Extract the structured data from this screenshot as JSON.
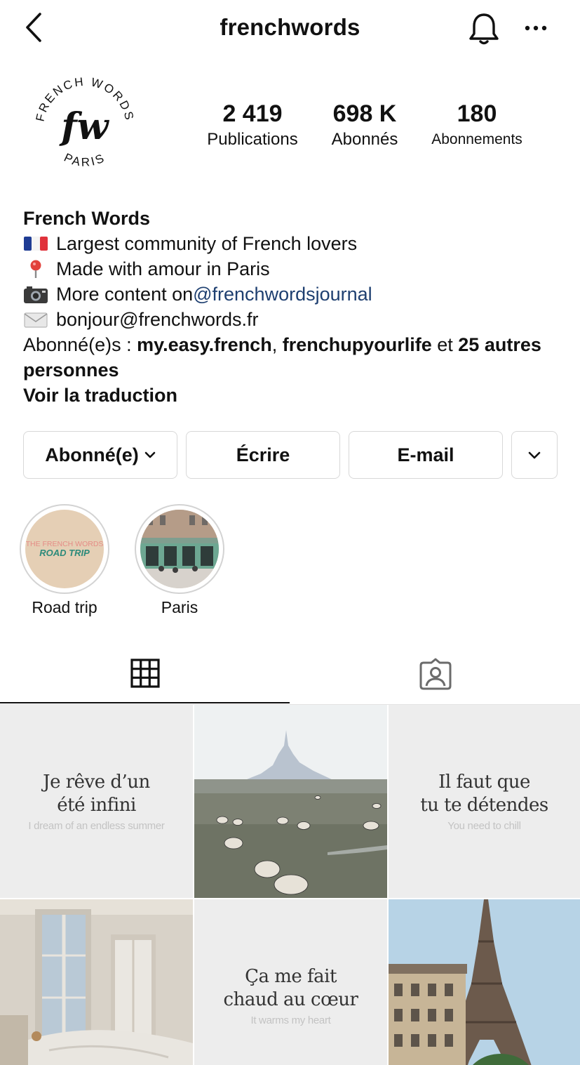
{
  "header": {
    "title": "frenchwords"
  },
  "profile": {
    "avatar_lines": {
      "top": "FRENCH WORDS",
      "bottom": "PARIS",
      "monogram": "fw"
    },
    "stats": [
      {
        "value": "2 419",
        "label": "Publications"
      },
      {
        "value": "698 K",
        "label": "Abonnés"
      },
      {
        "value": "180",
        "label": "Abonnements"
      }
    ],
    "name": "French Words",
    "bio_lines": [
      {
        "icon": "france-flag-icon",
        "text": "Largest community of French lovers"
      },
      {
        "icon": "pin-icon",
        "text": "Made with amour in Paris"
      },
      {
        "icon": "camera-icon",
        "text": "More content on ",
        "mention": "@frenchwordsjournal"
      },
      {
        "icon": "envelope-icon",
        "text": "bonjour@frenchwords.fr"
      }
    ],
    "followed_by": {
      "prefix": "Abonné(e)s : ",
      "user1": "my.easy.french",
      "sep": ", ",
      "user2": "frenchupyourlife",
      "mid": " et ",
      "others": "25 autres personnes"
    },
    "translate_label": "Voir la traduction"
  },
  "actions": {
    "follow_label": "Abonné(e)",
    "write_label": "Écrire",
    "email_label": "E-mail"
  },
  "highlights": [
    {
      "caption": "Road trip",
      "cover_text_top": "THE FRENCH WORDS",
      "cover_text_bottom": "ROAD TRIP"
    },
    {
      "caption": "Paris"
    }
  ],
  "posts": [
    {
      "fr_1": "Je rêve d’un",
      "fr_2": "été infini",
      "en": "I dream of an endless summer"
    },
    {
      "fr_1": "Il faut que",
      "fr_2": "tu te détendes",
      "en": "You need to chill"
    },
    {
      "fr_1": "Ça me fait",
      "fr_2": "chaud au cœur",
      "en": "It warms my heart"
    }
  ],
  "colors": {
    "mention": "#1e3f70",
    "border": "#d8d8d8",
    "quote_bg": "#ededed",
    "highlight_road_bg": "#e5cfb5",
    "road_trip_green": "#2c8a7a"
  }
}
